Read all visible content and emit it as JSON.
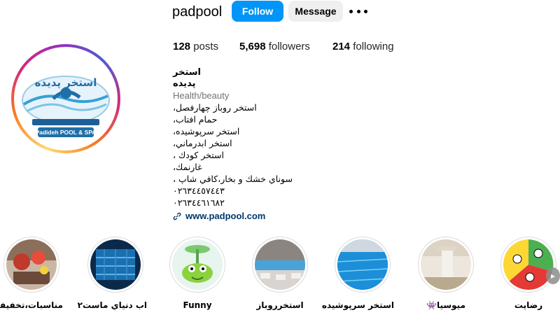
{
  "profile": {
    "username": "padpool",
    "follow_label": "Follow",
    "message_label": "Message",
    "logo_text": "استخر پدیده",
    "logo_banner": "Padideh POOL & SPA"
  },
  "stats": {
    "posts_count": "128",
    "posts_label": "posts",
    "followers_count": "5,698",
    "followers_label": "followers",
    "following_count": "214",
    "following_label": "following"
  },
  "bio": {
    "name": "استخر پديده",
    "category": "Health/beauty",
    "lines": [
      "استخر روباز چهارفصل،",
      "حمام افتاب،",
      "استخر سرپوشيده،",
      "استخر ابدرماني،",
      "استخر كودك ،",
      "غارنمك،",
      "سوناي خشك و بخار،كافي شاپ ،",
      "٠٢٦٣٤٤٥٧٤٤٣",
      "٠٢٦٣٤٤٦١٦٨٢"
    ],
    "website": "www.padpool.com"
  },
  "highlights": [
    {
      "label": "مناسبات،تخفيفها"
    },
    {
      "label": "اب دنياي ماست٢"
    },
    {
      "label": "Funny"
    },
    {
      "label": "استخرروباز"
    },
    {
      "label": "استخر سرپوشيده"
    },
    {
      "label": "ميوسيا👾"
    },
    {
      "label": "رضايت"
    }
  ],
  "colors": {
    "accent": "#0095f6",
    "secondary_button": "#efefef",
    "link": "#00376b",
    "muted": "#737373"
  },
  "icons": {
    "more": "more-options-icon",
    "link": "link-icon",
    "next": "chevron-right-icon"
  }
}
